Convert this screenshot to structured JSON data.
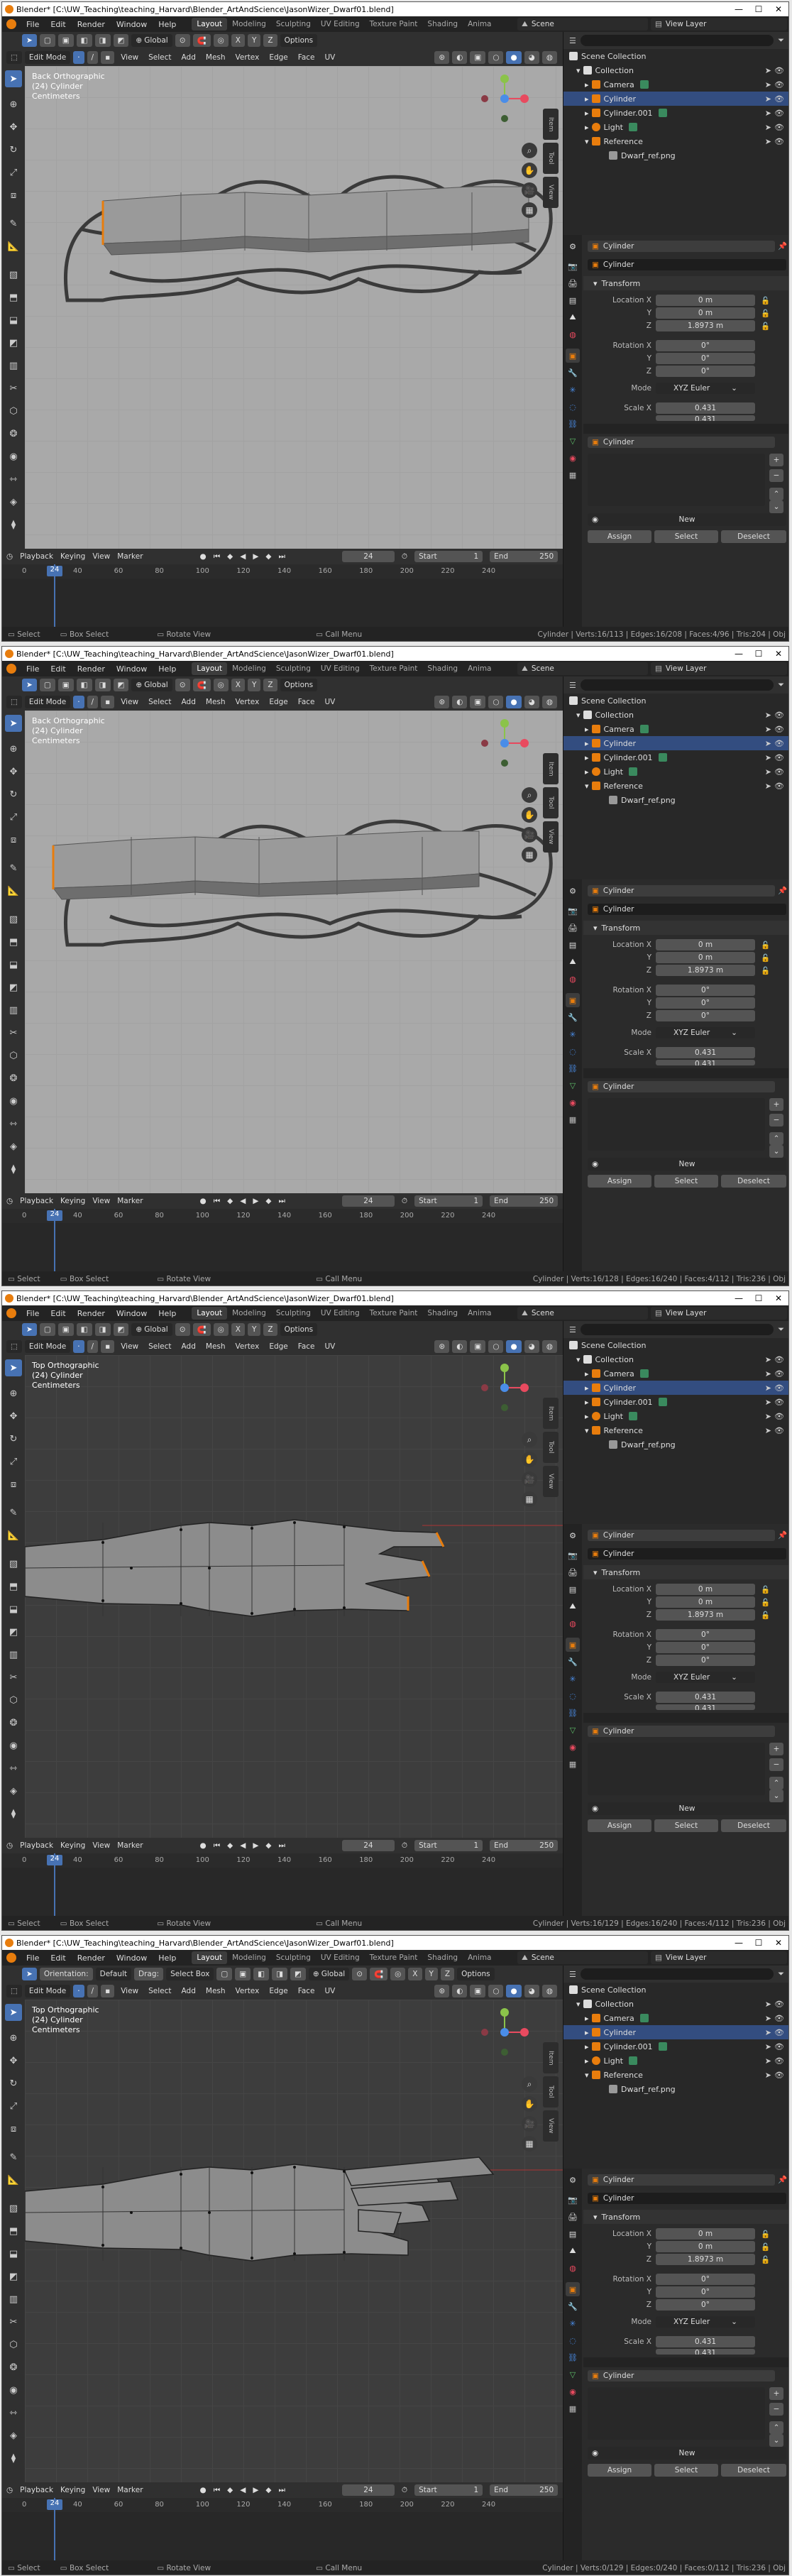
{
  "title": "Blender* [C:\\UW_Teaching\\teaching_Harvard\\Blender_ArtAndScience\\JasonWizer_Dwarf01.blend]",
  "window_buttons": [
    "—",
    "☐",
    "✕"
  ],
  "menu": [
    "File",
    "Edit",
    "Render",
    "Window",
    "Help"
  ],
  "workspaces": [
    "Layout",
    "Modeling",
    "Sculpting",
    "UV Editing",
    "Texture Paint",
    "Shading",
    "Anima"
  ],
  "scene": "Scene",
  "view_layer": "View Layer",
  "header": {
    "mode": "Edit Mode",
    "menus": [
      "View",
      "Select",
      "Add",
      "Mesh",
      "Vertex",
      "Edge",
      "Face",
      "UV"
    ],
    "transform": "Global",
    "axes": [
      "X",
      "Y",
      "Z"
    ],
    "options": "Options",
    "orientation_label": "Orientation:",
    "orientation_value": "Default",
    "drag_label": "Drag:",
    "drag_value": "Select Box"
  },
  "outliner": {
    "items": [
      "Scene Collection",
      "Collection",
      "Camera",
      "Cylinder",
      "Cylinder.001",
      "Light",
      "Reference",
      "Dwarf_ref.png"
    ]
  },
  "sidebar_tabs": [
    "Item",
    "Tool",
    "View"
  ],
  "properties": {
    "object_name": "Cylinder",
    "mesh_name": "Cylinder",
    "transform_label": "Transform",
    "location_label": "Location X",
    "y_label": "Y",
    "z_label": "Z",
    "location": [
      "0 m",
      "0 m",
      "1.8973 m"
    ],
    "rotation_label": "Rotation X",
    "rotation": [
      "0°",
      "0°",
      "0°"
    ],
    "mode_label": "Mode",
    "mode_value": "XYZ Euler",
    "scale_label": "Scale X",
    "scale": [
      "0.431",
      "0.431"
    ],
    "material_slot": "Cylinder",
    "new": "New",
    "assign": "Assign",
    "select": "Select",
    "deselect": "Deselect"
  },
  "timeline": {
    "menus": [
      "Playback",
      "Keying",
      "View",
      "Marker"
    ],
    "current_frame": "24",
    "start_label": "Start",
    "start": "1",
    "end_label": "End",
    "end": "250",
    "ruler": [
      "0",
      "40",
      "60",
      "80",
      "100",
      "120",
      "140",
      "160",
      "180",
      "200",
      "220",
      "240"
    ]
  },
  "status": {
    "select": "Select",
    "box_select": "Box Select",
    "rotate_view": "Rotate View",
    "call_menu": "Call Menu"
  },
  "screens": [
    {
      "view_name": "Back Orthographic",
      "object_line": "(24) Cylinder",
      "units": "Centimeters",
      "stats": "Cylinder | Verts:16/113 | Edges:16/208 | Faces:4/96 | Tris:204 | Obj",
      "has_orientation_header": false,
      "viewport_style": "grey"
    },
    {
      "view_name": "Back Orthographic",
      "object_line": "(24) Cylinder",
      "units": "Centimeters",
      "stats": "Cylinder | Verts:16/128 | Edges:16/240 | Faces:4/112 | Tris:236 | Obj",
      "has_orientation_header": false,
      "viewport_style": "grey"
    },
    {
      "view_name": "Top Orthographic",
      "object_line": "(24) Cylinder",
      "units": "Centimeters",
      "stats": "Cylinder | Verts:16/129 | Edges:16/240 | Faces:4/112 | Tris:236 | Obj",
      "has_orientation_header": false,
      "viewport_style": "dark"
    },
    {
      "view_name": "Top Orthographic",
      "object_line": "(24) Cylinder",
      "units": "Centimeters",
      "stats": "Cylinder | Verts:0/129 | Edges:0/240 | Faces:0/112 | Tris:236 | Obj",
      "has_orientation_header": true,
      "viewport_style": "dark"
    }
  ],
  "colors": {
    "accent": "#4772b3",
    "selected_row": "#334d80",
    "blender_orange": "#e87d0d",
    "axis_x": "#e84a5f",
    "axis_y": "#8bc34a",
    "axis_z": "#4a8de8"
  }
}
